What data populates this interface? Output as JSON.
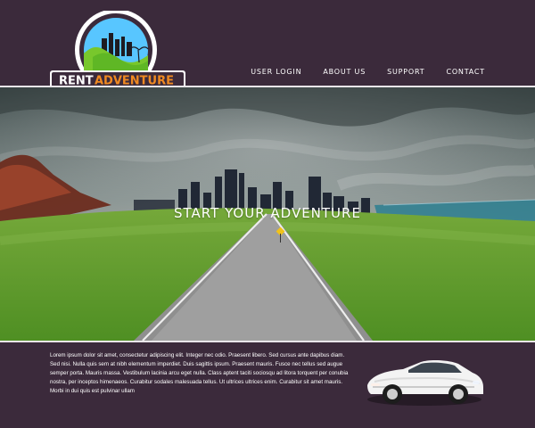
{
  "brand": {
    "name_part1": "RENT",
    "name_part2": "ADVENTURE",
    "colors": {
      "background": "#3b2a3b",
      "accent": "#f08a22",
      "sky": "#58c6ff",
      "grass": "#78c72c",
      "rule": "#e9e6ea"
    }
  },
  "nav": {
    "items": [
      {
        "label": "USER LOGIN"
      },
      {
        "label": "ABOUT US"
      },
      {
        "label": "SUPPORT"
      },
      {
        "label": "CONTACT"
      }
    ]
  },
  "hero": {
    "title": "START YOUR ADVENTURE"
  },
  "content": {
    "body": "Lorem ipsum dolor sit amet, consectetur adipiscing elit. Integer nec odio. Praesent libero. Sed cursus ante dapibus diam. Sed nisi. Nulla quis sem at nibh elementum imperdiet. Duis sagittis ipsum. Praesent mauris. Fusce nec tellus sed augue semper porta. Mauris massa. Vestibulum lacinia arcu eget nulla. Class aptent taciti sociosqu ad litora torquent per conubia nostra, per inceptos himenaeos. Curabitur sodales malesuada tellus. Ut ultrices ultrices enim. Curabitur sit amet mauris. Morbi in dui quis est pulvinar ullam"
  },
  "icons": {
    "logo": "city-skyline-emblem-logo",
    "car": "white-suv-car-image"
  }
}
